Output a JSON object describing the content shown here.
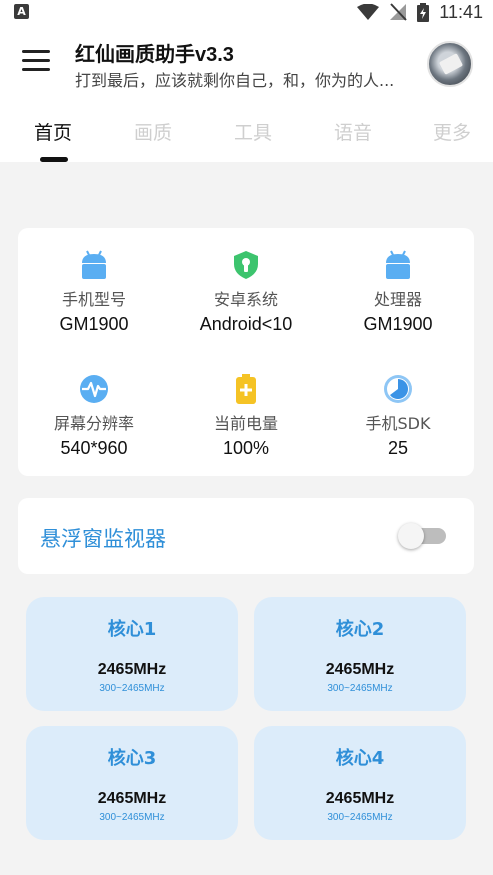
{
  "status_bar": {
    "time": "11:41",
    "left_icon_letter": "A",
    "icons": [
      "notification-a-icon",
      "wifi-icon",
      "no-signal-icon",
      "battery-charging-icon"
    ]
  },
  "app_bar": {
    "title": "红仙画质助手v3.3",
    "subtitle": "打到最后，应该就剩你自己，和，你为的人..."
  },
  "tabs": [
    {
      "label": "首页",
      "active": true
    },
    {
      "label": "画质",
      "active": false
    },
    {
      "label": "工具",
      "active": false
    },
    {
      "label": "语音",
      "active": false
    },
    {
      "label": "更多",
      "active": false
    }
  ],
  "device_info": [
    {
      "label": "手机型号",
      "value": "GM1900",
      "icon": "android-icon",
      "color": "#5aaef2"
    },
    {
      "label": "安卓系统",
      "value": "Android<10",
      "icon": "shield-lock-icon",
      "color": "#3dc46e"
    },
    {
      "label": "处理器",
      "value": "GM1900",
      "icon": "android-icon",
      "color": "#5aaef2"
    },
    {
      "label": "屏幕分辨率",
      "value": "540*960",
      "icon": "pulse-icon",
      "color": "#5aaef2"
    },
    {
      "label": "当前电量",
      "value": "100%",
      "icon": "battery-plus-icon",
      "color": "#f5c325"
    },
    {
      "label": "手机SDK",
      "value": "25",
      "icon": "pie-chart-icon",
      "color": "#3a93e6"
    }
  ],
  "monitor": {
    "label": "悬浮窗监视器",
    "enabled": false
  },
  "cores": [
    {
      "name": "核心1",
      "freq": "2465MHz",
      "range": "300~2465MHz"
    },
    {
      "name": "核心2",
      "freq": "2465MHz",
      "range": "300~2465MHz"
    },
    {
      "name": "核心3",
      "freq": "2465MHz",
      "range": "300~2465MHz"
    },
    {
      "name": "核心4",
      "freq": "2465MHz",
      "range": "300~2465MHz"
    }
  ],
  "colors": {
    "accent": "#2f8fd8",
    "core_bg": "#dcecfa",
    "page_bg": "#f3f3f3"
  }
}
